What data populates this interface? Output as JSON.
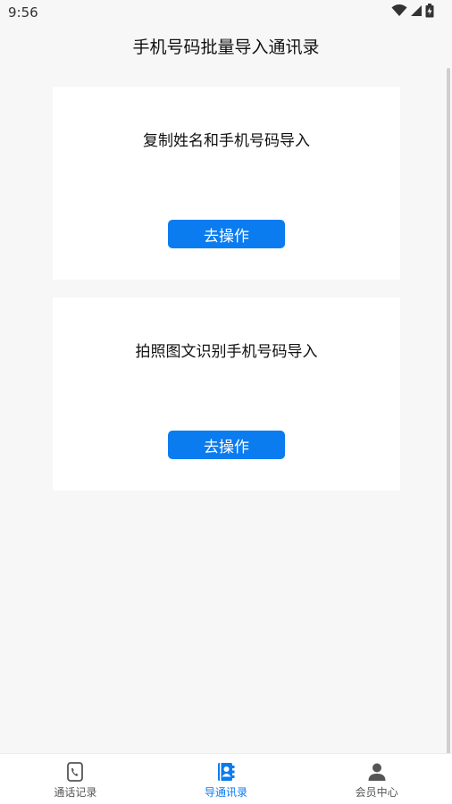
{
  "status_bar": {
    "time": "9:56",
    "icons": [
      "wifi-icon",
      "signal-icon",
      "battery-icon"
    ]
  },
  "header": {
    "title": "手机号码批量导入通讯录"
  },
  "cards": [
    {
      "title": "复制姓名和手机号码导入",
      "button_label": "去操作"
    },
    {
      "title": "拍照图文识别手机号码导入",
      "button_label": "去操作"
    }
  ],
  "bottom_nav": {
    "items": [
      {
        "label": "通话记录",
        "icon": "call-log-icon",
        "active": false
      },
      {
        "label": "导通讯录",
        "icon": "contacts-book-icon",
        "active": true
      },
      {
        "label": "会员中心",
        "icon": "person-icon",
        "active": false
      }
    ]
  },
  "colors": {
    "accent": "#0a7cf0",
    "background": "#f7f7f7",
    "card": "#ffffff",
    "inactive_icon": "#555555"
  }
}
